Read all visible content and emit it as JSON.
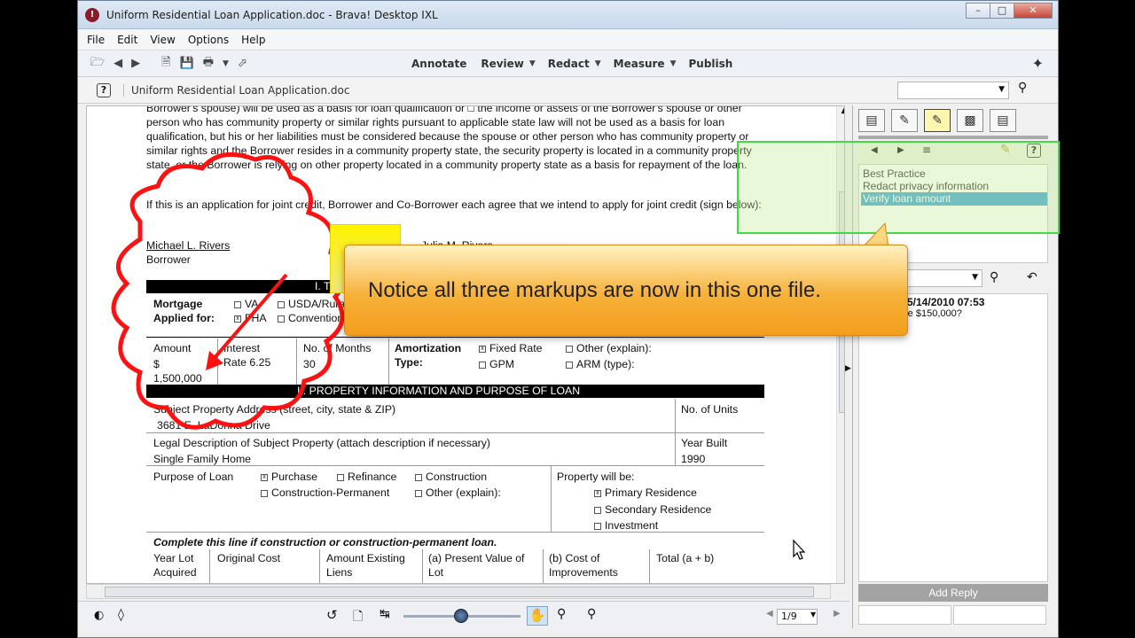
{
  "window": {
    "title": "Uniform Residential Loan Application.doc - Brava! Desktop IXL",
    "app_icon": "brava-icon",
    "controls": [
      "minimize",
      "maximize",
      "close"
    ]
  },
  "menu": [
    "File",
    "Edit",
    "View",
    "Options",
    "Help"
  ],
  "toolbar": {
    "annotate": "Annotate",
    "review": "Review",
    "redact": "Redact",
    "measure": "Measure",
    "publish": "Publish"
  },
  "docbar": {
    "help": "?",
    "doc_name": "Uniform Residential Loan Application.doc"
  },
  "document": {
    "paragraph": "Borrower's spouse) will be used as a basis for loan qualification or □ the income or assets of the Borrower's spouse or other person who has community property or similar rights pursuant to applicable state law will not be used as a basis for loan qualification, but his or her liabilities must be considered because the spouse or other person who has community property or similar rights and the Borrower resides in a community property state, the security property is located in a community property state, or the Borrower is relying on other property located in a community property state as a basis for repayment of the loan.",
    "joint_credit": "If this is an application for joint credit, Borrower and Co-Borrower each agree that we intend to apply for joint credit (sign below):",
    "borrower_name": "Michael L. Rivers",
    "borrower_label": "Borrower",
    "coborrower_name": "Julia M. Rivers",
    "section1": "I. TYPE OF MORTGAGE AND TERMS OF LOAN",
    "mortgage_label1": "Mortgage",
    "mortgage_label2": "Applied for:",
    "va": "VA",
    "fha": "FHA",
    "usda": "USDA/Rural",
    "conventional": "Conventional",
    "amount_label": "Amount",
    "amount_dollar": "$",
    "amount_value": "1,500,000",
    "interest_label": "Interest",
    "interest_rate": "Rate 6.25",
    "months_label": "No. of Months",
    "months_value": "30",
    "amort_label1": "Amortization",
    "amort_label2": "Type:",
    "fixed_rate": "Fixed Rate",
    "gpm": "GPM",
    "other_explain": "Other (explain):",
    "arm": "ARM (type):",
    "section2": "II. PROPERTY INFORMATION AND PURPOSE OF LOAN",
    "subject_property": "Subject Property Address (street, city, state & ZIP)",
    "address": "3681 E. LaDonna Drive",
    "units_label": "No. of Units",
    "legal_desc": "Legal Description of Subject Property (attach description if necessary)",
    "legal_value": "Single Family Home",
    "year_built_label": "Year Built",
    "year_built": "1990",
    "purpose_label": "Purpose of Loan",
    "purchase": "Purchase",
    "refinance": "Refinance",
    "construction": "Construction",
    "construction_perm": "Construction-Permanent",
    "other_purpose": "Other (explain):",
    "property_will_be": "Property will be:",
    "primary": "Primary Residence",
    "secondary": "Secondary Residence",
    "investment": "Investment",
    "complete_line": "Complete this line if construction or construction-permanent loan.",
    "year_lot1": "Year Lot",
    "year_lot2": "Acquired",
    "original_cost": "Original Cost",
    "amount_existing1": "Amount Existing",
    "amount_existing2": "Liens",
    "present_value1": "(a) Present Value of",
    "present_value2": "Lot",
    "cost_improvements1": "(b) Cost of",
    "cost_improvements2": "Improvements",
    "total": "Total (a + b)"
  },
  "callout": {
    "text": "Notice all three markups are now in this one file."
  },
  "right_panel": {
    "markups": [
      "Best Practice",
      "Redact privacy information",
      "Verify loan amount"
    ],
    "selected_index": 2,
    "comment_header": "m 5/14/2010 07:53",
    "comment_text": "s be $150,000?",
    "add_reply": "Add Reply"
  },
  "status": {
    "page": "1/9",
    "zoom_fraction": 0.48
  }
}
